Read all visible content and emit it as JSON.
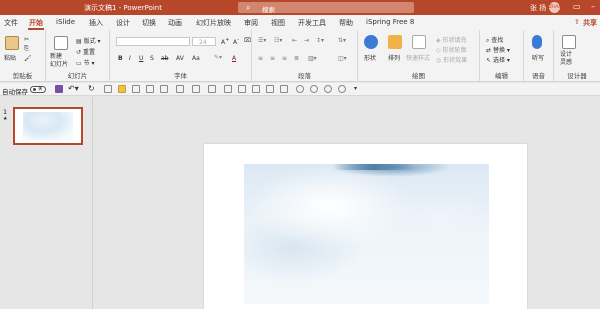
{
  "titlebar": {
    "doc_title": "演示文稿1  -  PowerPoint",
    "search_placeholder": "搜索",
    "user_name": "张 扬",
    "avatar_text": "ZHAN"
  },
  "tabs": [
    "文件",
    "开始",
    "iSlide",
    "插入",
    "设计",
    "切换",
    "动画",
    "幻灯片放映",
    "审阅",
    "视图",
    "开发工具",
    "帮助",
    "iSpring Free 8"
  ],
  "share_label": "共享",
  "ribbon": {
    "groups": {
      "clipboard": "剪贴板",
      "slides": "幻灯片",
      "font": "字体",
      "paragraph": "段落",
      "drawing": "绘图",
      "editing": "编辑",
      "voice": "语音",
      "designer": "设计器"
    },
    "paste": "粘贴",
    "new_slide": "新建\n幻灯片",
    "layout": "版式",
    "reset": "重置",
    "section": "节",
    "font_size": "24",
    "font_buttons": [
      "B",
      "I",
      "U",
      "S",
      "ab",
      "AV",
      "Aa",
      "A"
    ],
    "shapes": "形状",
    "arrange": "排列",
    "quick_styles": "快速样式",
    "shape_fill": "形状填充",
    "shape_outline": "形状轮廓",
    "shape_effects": "形状效果",
    "find": "查找",
    "replace": "替换",
    "select": "选择",
    "dictate": "听写",
    "design_ideas": "设计\n灵感"
  },
  "quickbar": {
    "autosave": "自动保存",
    "toggle": "关"
  },
  "slides_panel": {
    "slide_number": "1",
    "star": "★"
  },
  "colors": {
    "accent": "#b7472a"
  }
}
